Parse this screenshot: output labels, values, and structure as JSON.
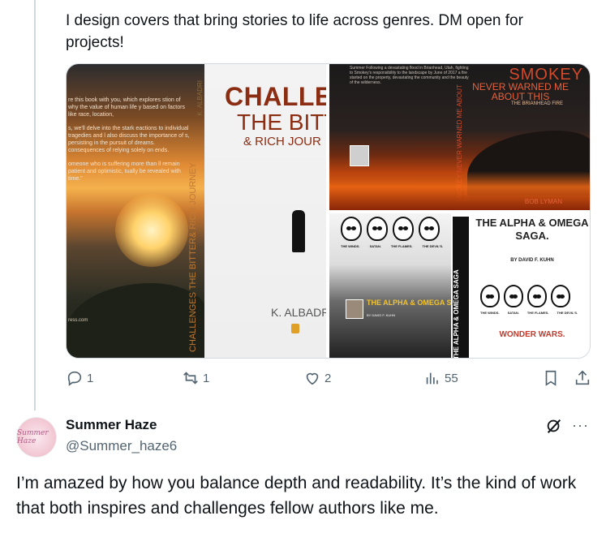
{
  "post": {
    "text": "I design covers that bring stories to life across genres. DM open for projects!"
  },
  "media": {
    "cover_left": {
      "back_blurb": [
        "re this book with you, which explores stion of why the value of human life y based on factors like race, location,",
        "s, we'll delve into the stark eactions to individual tragedies and l also discuss the importance of s, persisting in the pursuit of dreams. consequences of relying solely on ends.",
        "omeone who is suffering more than ll remain patient and optimistic, tually be revealed with time.\""
      ],
      "spine_title": "CHALLENGES THE BITTER& RICH JOURNEY",
      "spine_author": "K. ALBADRI",
      "title_line1": "CHALLEN",
      "title_line2": "THE BITT",
      "title_line3": "& RICH JOUR",
      "author": "K. ALBADR",
      "url_fragment": "ress.com"
    },
    "cover_top_right": {
      "title": "SMOKEY",
      "subtitle_line1": "NEVER WARNED ME",
      "subtitle_line2": "ABOUT THIS",
      "tagline": "THE BRIANHEAD FIRE",
      "spine": "SMOKEY NEVER WARNED ME ABOUT THIS",
      "author": "BOB LYMAN"
    },
    "cover_bottom_right": {
      "face_captions": [
        "THE WINDS.",
        "SATAN.",
        "THE FLAMES.",
        "THE DEVIL'S."
      ],
      "back_title": "THE ALPHA & OMEGA SAGA",
      "back_by": "BY DAVID F. KUHN",
      "spine": "THE ALPHA & OMEGA SAGA",
      "front_title": "THE ALPHA & OMEGA SAGA.",
      "front_by": "BY DAVID F. KUHN",
      "tagline": "WONDER WARS."
    }
  },
  "actions": {
    "replies": "1",
    "reposts": "1",
    "likes": "2",
    "views": "55"
  },
  "reply": {
    "avatar_text": "Summer Haze",
    "name": "Summer Haze",
    "handle": "@Summer_haze6",
    "more": "···",
    "text": "I’m amazed by how you balance depth and readability. It’s the kind of work that both inspires and challenges fellow authors like me."
  }
}
